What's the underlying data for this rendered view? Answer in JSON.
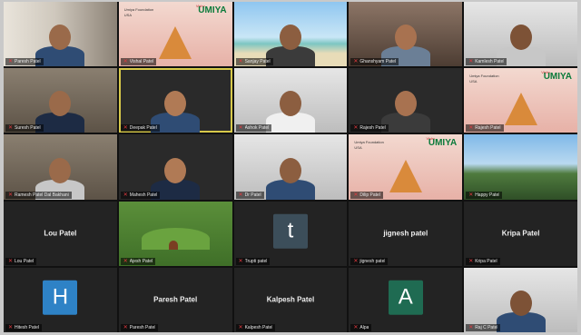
{
  "meeting": {
    "participants": [
      {
        "id": "p1",
        "name": "Paresh Patel",
        "kind": "video",
        "bg": "window"
      },
      {
        "id": "p2",
        "name": "Vishal Patel",
        "kind": "slide",
        "bg": "temple"
      },
      {
        "id": "p3",
        "name": "Sanjay Patel",
        "kind": "video",
        "bg": "beach"
      },
      {
        "id": "p4",
        "name": "Ghanshyam Patel",
        "kind": "video",
        "bg": "office"
      },
      {
        "id": "p5",
        "name": "Kamlesh Patel",
        "kind": "video",
        "bg": "light"
      },
      {
        "id": "p6",
        "name": "Suresh Patel",
        "kind": "video",
        "bg": "room"
      },
      {
        "id": "p7",
        "name": "Deepak Patel",
        "kind": "video",
        "bg": "dark",
        "speaking": true
      },
      {
        "id": "p8",
        "name": "Ashok Patel",
        "kind": "video",
        "bg": "light"
      },
      {
        "id": "p9",
        "name": "Rajesh Patel",
        "kind": "video",
        "bg": "dark"
      },
      {
        "id": "p10",
        "name": "Rajesh Patel",
        "kind": "slide",
        "bg": "temple"
      },
      {
        "id": "p11",
        "name": "Ramesh Patel Dal Bakhani",
        "kind": "video",
        "bg": "room"
      },
      {
        "id": "p12",
        "name": "Mahesh Patel",
        "kind": "video",
        "bg": "dark"
      },
      {
        "id": "p13",
        "name": "Dr Patel",
        "kind": "video",
        "bg": "light"
      },
      {
        "id": "p14",
        "name": "Dilip Patel",
        "kind": "slide",
        "bg": "temple"
      },
      {
        "id": "p15",
        "name": "Happy Patel",
        "kind": "image",
        "bg": "mountain"
      },
      {
        "id": "p16",
        "name": "Lou Patel",
        "kind": "name"
      },
      {
        "id": "p17",
        "name": "Ajesh Patel",
        "kind": "image",
        "bg": "garden"
      },
      {
        "id": "p18",
        "name": "Trupti patel",
        "kind": "avatar",
        "letter": "t",
        "color": "#3c4e5a"
      },
      {
        "id": "p19",
        "name": "jignesh patel",
        "kind": "name"
      },
      {
        "id": "p20",
        "name": "Kripa Patel",
        "kind": "name"
      },
      {
        "id": "p21",
        "name": "Hitesh Patel",
        "kind": "avatar",
        "letter": "H",
        "color": "#2e82c6"
      },
      {
        "id": "p22",
        "name": "Paresh Patel",
        "kind": "name"
      },
      {
        "id": "p23",
        "name": "Kalpesh Patel",
        "kind": "name"
      },
      {
        "id": "p24",
        "name": "Alpa",
        "kind": "avatar",
        "letter": "A",
        "color": "#1f6b52"
      },
      {
        "id": "p25",
        "name": "Raj C Patel",
        "kind": "video",
        "bg": "light"
      }
    ],
    "slide": {
      "brand": "UMIYA",
      "brand_prefix": "Vishv",
      "line1": "Umiya Foundation",
      "line2": "USA",
      "nj_title": "New Jersey",
      "nj_sub": "Chapter"
    },
    "colors": {
      "muted_mic": "#e0393e",
      "speaking_border": "#d7c94a",
      "tile_bg": "#232323"
    }
  }
}
